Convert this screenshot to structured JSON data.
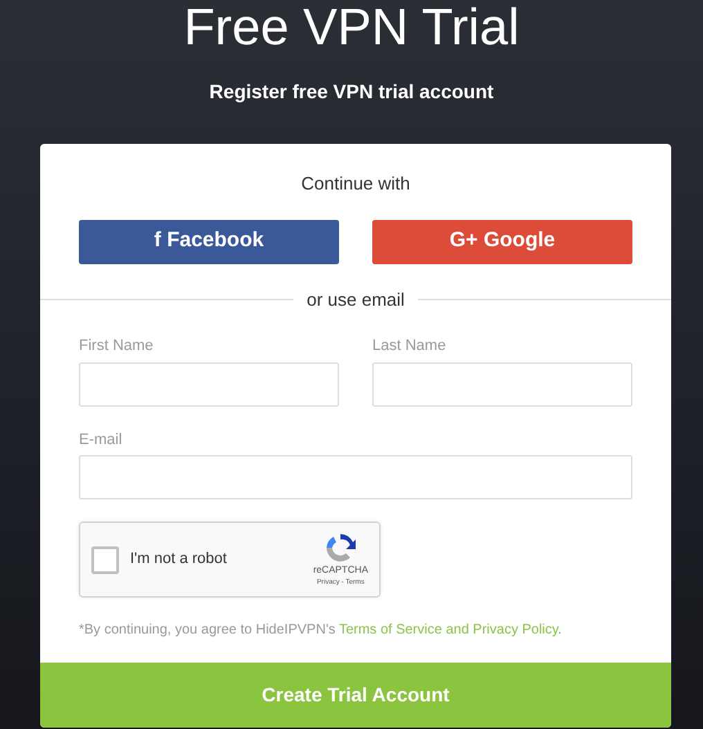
{
  "header": {
    "title": "Free VPN Trial",
    "subtitle": "Register free VPN trial account"
  },
  "social": {
    "heading": "Continue with",
    "buttons": [
      {
        "kind": "facebook",
        "icon": "f",
        "label": "Facebook"
      },
      {
        "kind": "google",
        "icon": "G+",
        "label": "Google"
      }
    ]
  },
  "divider": "or use email",
  "fields": [
    {
      "label": "First Name",
      "kind": "half"
    },
    {
      "label": "Last Name",
      "kind": "half"
    },
    {
      "label": "E-mail",
      "kind": "wide"
    }
  ],
  "captcha": {
    "label": "I'm not a robot",
    "checked": false,
    "brand": "reCAPTCHA",
    "links": "Privacy - Terms"
  },
  "terms": {
    "before": "*By continuing, you agree to HideIPVPN's ",
    "link": "Terms of Service and Privacy Policy",
    "after": "."
  },
  "submit": "Create Trial Account"
}
